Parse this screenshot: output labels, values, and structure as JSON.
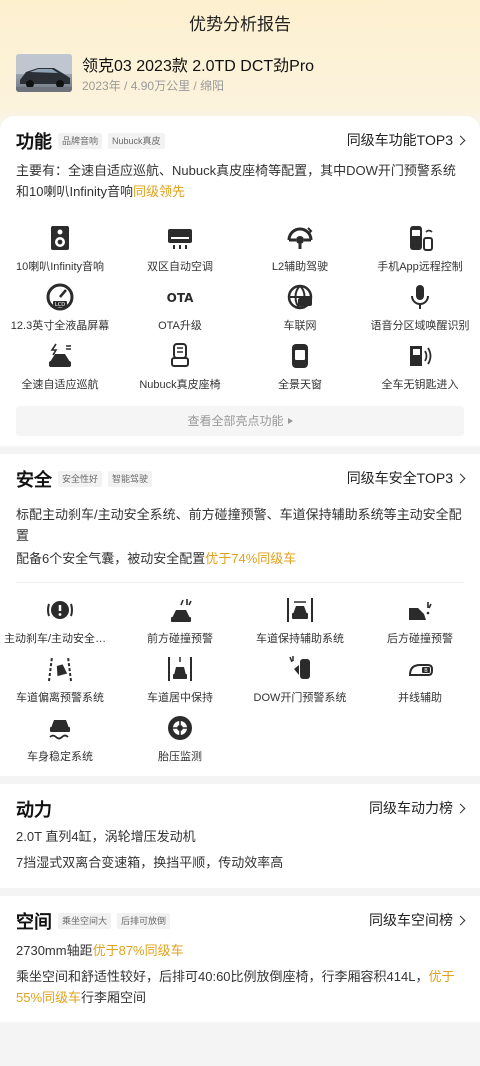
{
  "page": {
    "title": "优势分析报告"
  },
  "car": {
    "name": "领克03 2023款 2.0TD DCT劲Pro",
    "year": "2023年",
    "mileage": "4.90万公里",
    "city": "绵阳",
    "sep": " / "
  },
  "features": {
    "title": "功能",
    "tags": [
      "品牌音响",
      "Nubuck真皮"
    ],
    "link": "同级车功能TOP3",
    "summary_text": "主要有：全速自适应巡航、Nubuck真皮座椅等配置，其中DOW开门预警系统和10喇叭Infinity音响",
    "summary_highlight": "同级领先",
    "items": [
      {
        "label": "10喇叭Infinity音响",
        "icon": "speaker-icon"
      },
      {
        "label": "双区自动空调",
        "icon": "air-conditioner-icon"
      },
      {
        "label": "L2辅助驾驶",
        "icon": "steering-wheel-icon"
      },
      {
        "label": "手机App远程控制",
        "icon": "remote-app-icon"
      },
      {
        "label": "12.3英寸全液晶屏幕",
        "icon": "lcd-gauge-icon"
      },
      {
        "label": "OTA升级",
        "icon": "ota-icon",
        "icon_text": "OTA"
      },
      {
        "label": "车联网",
        "icon": "connected-car-icon"
      },
      {
        "label": "语音分区域唤醒识别",
        "icon": "microphone-icon"
      },
      {
        "label": "全速自适应巡航",
        "icon": "adaptive-cruise-icon"
      },
      {
        "label": "Nubuck真皮座椅",
        "icon": "seat-icon"
      },
      {
        "label": "全景天窗",
        "icon": "sunroof-icon"
      },
      {
        "label": "全车无钥匙进入",
        "icon": "keyless-entry-icon"
      }
    ],
    "more_label": "查看全部亮点功能"
  },
  "safety": {
    "title": "安全",
    "tags": [
      "安全性好",
      "智能驾驶"
    ],
    "link": "同级车安全TOP3",
    "summary1": "标配主动刹车/主动安全系统、前方碰撞预警、车道保持辅助系统等主动安全配置",
    "summary2_text": "配备6个安全气囊，被动安全配置",
    "summary2_highlight": "优于74%同级车",
    "items": [
      {
        "label": "主动刹车/主动安全系统",
        "icon": "brake-warning-icon"
      },
      {
        "label": "前方碰撞预警",
        "icon": "forward-collision-icon"
      },
      {
        "label": "车道保持辅助系统",
        "icon": "lane-keep-icon"
      },
      {
        "label": "后方碰撞预警",
        "icon": "rear-collision-icon"
      },
      {
        "label": "车道偏离预警系统",
        "icon": "lane-departure-icon"
      },
      {
        "label": "车道居中保持",
        "icon": "lane-center-icon"
      },
      {
        "label": "DOW开门预警系统",
        "icon": "door-open-warning-icon"
      },
      {
        "label": "并线辅助",
        "icon": "blind-spot-icon"
      },
      {
        "label": "车身稳定系统",
        "icon": "stability-control-icon"
      },
      {
        "label": "胎压监测",
        "icon": "tire-pressure-icon"
      }
    ]
  },
  "power": {
    "title": "动力",
    "link": "同级车动力榜",
    "line1": "2.0T 直列4缸，涡轮增压发动机",
    "line2": "7挡湿式双离合变速箱，换挡平顺，传动效率高"
  },
  "space": {
    "title": "空间",
    "tags": [
      "乘坐空间大",
      "后排可放倒"
    ],
    "link": "同级车空间榜",
    "line1_text": "2730mm轴距",
    "line1_highlight": "优于87%同级车",
    "line2_text": "乘坐空间和舒适性较好，后排可40:60比例放倒座椅，行李厢容积414L，",
    "line2_highlight": "优于55%同级车",
    "line2_tail": "行李厢空间"
  },
  "colors": {
    "accent": "#e0a21c",
    "header_bg": "#fdf0cf",
    "page_bg": "#f4f4f4"
  }
}
